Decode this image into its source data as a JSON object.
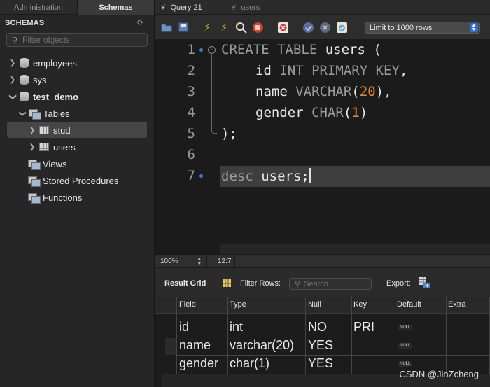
{
  "top_tabs": {
    "administration": "Administration",
    "schemas": "Schemas",
    "query_tab": "Query 21",
    "users_tab": "users"
  },
  "sidebar": {
    "title": "SCHEMAS",
    "filter_placeholder": "Filter objects",
    "items": [
      {
        "label": "employees",
        "kind": "database",
        "expanded": false
      },
      {
        "label": "sys",
        "kind": "database",
        "expanded": false
      },
      {
        "label": "test_demo",
        "kind": "database",
        "expanded": true,
        "bold": true
      },
      {
        "label": "Tables",
        "kind": "folder",
        "expanded": true,
        "selected": true
      },
      {
        "label": "stud",
        "kind": "table",
        "expanded": false
      },
      {
        "label": "users",
        "kind": "table",
        "expanded": false
      },
      {
        "label": "Views",
        "kind": "folder"
      },
      {
        "label": "Stored Procedures",
        "kind": "folder"
      },
      {
        "label": "Functions",
        "kind": "folder"
      }
    ]
  },
  "toolbar": {
    "icons": [
      "open-folder-icon",
      "save-icon",
      "execute-bolt-icon",
      "execute-current-bolt-icon",
      "explain-magnifier-icon",
      "stop-icon",
      "toggle-error-icon",
      "commit-icon",
      "rollback-icon",
      "autocommit-icon"
    ],
    "limit_select": "Limit to 1000 rows"
  },
  "editor": {
    "line_numbers": [
      "1",
      "2",
      "3",
      "4",
      "5",
      "6",
      "7"
    ],
    "lines": {
      "l1_kw": "CREATE TABLE",
      "l1_rest": " users (",
      "l2_col": "id",
      "l2_kw": "INT PRIMARY KEY",
      "l2_rest": ",",
      "l3_col": "name",
      "l3_kw": "VARCHAR",
      "l3_open": "(",
      "l3_num": "20",
      "l3_close": "),",
      "l4_col": "gender",
      "l4_kw": "CHAR",
      "l4_open": "(",
      "l4_num": "1",
      "l4_close": ")",
      "l5": ");",
      "l7_kw": "desc",
      "l7_rest": " users;"
    },
    "current_line": 7
  },
  "status": {
    "zoom": "100%",
    "cursor_position": "12:7"
  },
  "result_toolbar": {
    "result_grid_label": "Result Grid",
    "filter_rows_label": "Filter Rows:",
    "search_placeholder": "Search",
    "export_label": "Export:"
  },
  "result_grid": {
    "columns": [
      "Field",
      "Type",
      "Null",
      "Key",
      "Default",
      "Extra"
    ],
    "rows": [
      {
        "field": "id",
        "type": "int",
        "null": "NO",
        "key": "PRI",
        "default": "NULL",
        "extra": ""
      },
      {
        "field": "name",
        "type": "varchar(20)",
        "null": "YES",
        "key": "",
        "default": "NULL",
        "extra": ""
      },
      {
        "field": "gender",
        "type": "char(1)",
        "null": "YES",
        "key": "",
        "default": "NULL",
        "extra": ""
      }
    ]
  },
  "watermark": "CSDN @JinZcheng",
  "colors": {
    "accent_blue": "#3f7bd6",
    "number_orange": "#e08a3a",
    "keyword_gray": "#9c9c9c"
  }
}
